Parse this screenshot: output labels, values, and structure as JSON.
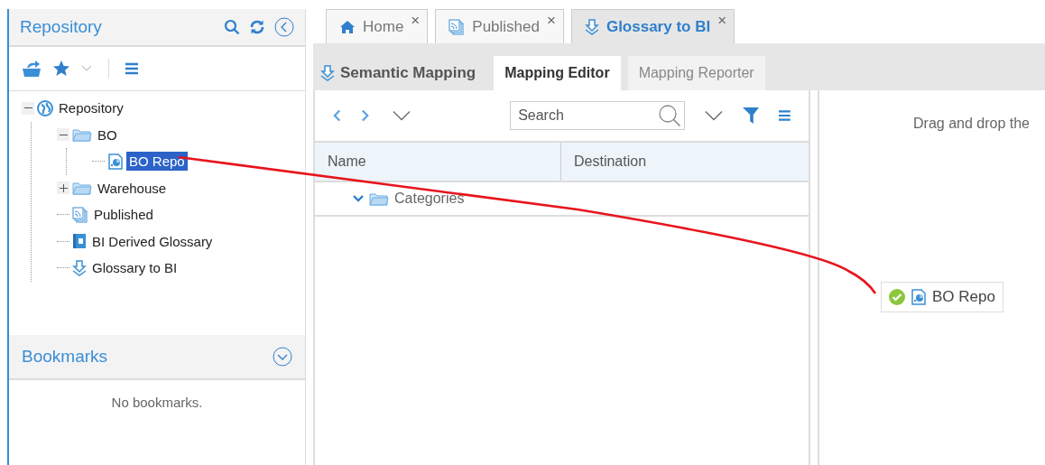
{
  "sidebar": {
    "title": "Repository",
    "tree": [
      {
        "label": "Repository",
        "kind": "root",
        "expanded": true,
        "selected": false,
        "children": [
          {
            "label": "BO",
            "kind": "folder",
            "expanded": true,
            "selected": false,
            "children": [
              {
                "label": "BO Repo",
                "kind": "report",
                "selected": true
              }
            ]
          },
          {
            "label": "Warehouse",
            "kind": "folder",
            "expanded": false,
            "selected": false
          },
          {
            "label": "Published",
            "kind": "publication",
            "selected": false
          },
          {
            "label": "BI Derived Glossary",
            "kind": "glossary",
            "selected": false
          },
          {
            "label": "Glossary to BI",
            "kind": "mapping",
            "selected": false
          }
        ]
      }
    ],
    "bookmarks": {
      "title": "Bookmarks",
      "empty_text": "No bookmarks."
    }
  },
  "tabs": [
    {
      "label": "Home",
      "kind": "home",
      "close": "×",
      "selected": false
    },
    {
      "label": "Published",
      "kind": "publication",
      "close": "×",
      "selected": false
    },
    {
      "label": "Glossary to BI",
      "kind": "mapping",
      "close": "×",
      "selected": true
    }
  ],
  "subtabs": [
    {
      "label": "Semantic Mapping",
      "kind": "title"
    },
    {
      "label": "Mapping Editor",
      "kind": "tab",
      "selected": true
    },
    {
      "label": "Mapping Reporter",
      "kind": "tab",
      "selected": false
    }
  ],
  "search": {
    "placeholder": "Search"
  },
  "table": {
    "columns": [
      "Name",
      "Destination"
    ],
    "rows": [
      {
        "name": "Categories",
        "expanded": true
      }
    ]
  },
  "drop_area": {
    "hint": "Drag and drop the",
    "item": {
      "label": "BO Repo",
      "valid": true
    }
  }
}
